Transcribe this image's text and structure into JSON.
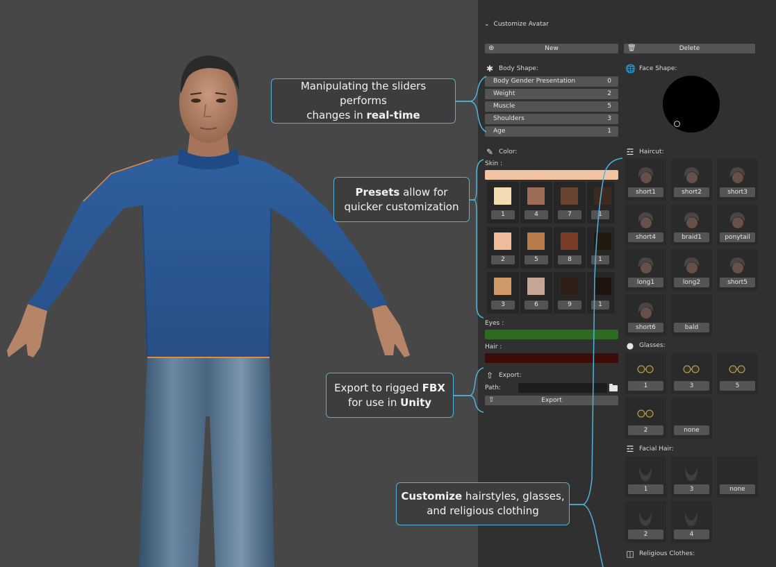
{
  "callouts": {
    "sliders": {
      "line1": "Manipulating the sliders performs",
      "line2_prefix": "changes in ",
      "line2_bold": "real-time"
    },
    "presets": {
      "line1_bold": "Presets",
      "line1_rest": " allow for",
      "line2": "quicker customization"
    },
    "export": {
      "line1_prefix": "Export to rigged ",
      "line1_bold": "FBX",
      "line2_prefix": "for use in ",
      "line2_bold": "Unity"
    },
    "customize": {
      "line1_bold": "Customize",
      "line1_rest": " hairstyles, glasses,",
      "line2": "and religious clothing"
    }
  },
  "panel": {
    "header": "Customize Avatar",
    "new_label": "New",
    "delete_label": "Delete",
    "body_shape_label": "Body Shape:",
    "face_shape_label": "Face Shape:",
    "sliders": [
      {
        "label": "Body Gender Presentation",
        "value": "0"
      },
      {
        "label": "Weight",
        "value": "2"
      },
      {
        "label": "Muscle",
        "value": "5"
      },
      {
        "label": "Shoulders",
        "value": "3"
      },
      {
        "label": "Age",
        "value": "1"
      }
    ],
    "color_label": "Color:",
    "skin_label": "Skin :",
    "skin_color": "#f0c3a2",
    "skin_presets": [
      {
        "label": "1",
        "color": "#f3dcb0"
      },
      {
        "label": "4",
        "color": "#9c6e55"
      },
      {
        "label": "7",
        "color": "#684431"
      },
      {
        "label": "1",
        "color": "#3e2a20"
      },
      {
        "label": "2",
        "color": "#eebd98"
      },
      {
        "label": "5",
        "color": "#b97c47"
      },
      {
        "label": "8",
        "color": "#7b3b24"
      },
      {
        "label": "1",
        "color": "#22190f"
      },
      {
        "label": "3",
        "color": "#cf9a64"
      },
      {
        "label": "6",
        "color": "#c7a596"
      },
      {
        "label": "9",
        "color": "#2d1f15"
      },
      {
        "label": "1",
        "color": "#1f1410"
      }
    ],
    "eyes_label": "Eyes :",
    "eyes_color": "#2e6b22",
    "hair_label": "Hair :",
    "hair_color": "#3b0c08",
    "export_label": "Export:",
    "path_label": "Path:",
    "path_value": "",
    "export_button": "Export",
    "haircut_label": "Haircut:",
    "haircuts": [
      "short1",
      "short2",
      "short3",
      "short4",
      "braid1",
      "ponytail",
      "long1",
      "long2",
      "short5",
      "short6",
      "bald"
    ],
    "glasses_label": "Glasses:",
    "glasses": [
      "1",
      "3",
      "5",
      "2",
      "none"
    ],
    "facial_hair_label": "Facial Hair:",
    "facial_hair": [
      "1",
      "3",
      "none",
      "2",
      "4"
    ],
    "religious_label": "Religious Clothes:"
  },
  "colors": {
    "accent": "#4fb4de",
    "panel_bg": "#303030",
    "viewport_bg": "#474747"
  }
}
